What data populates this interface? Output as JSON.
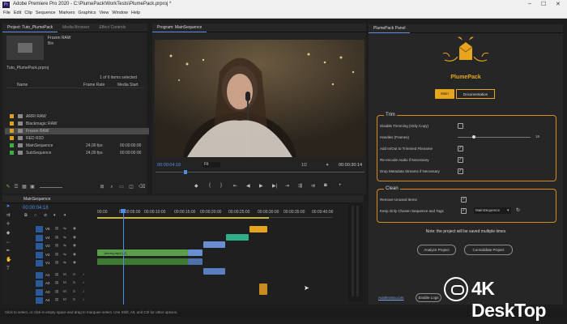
{
  "window": {
    "title": "Adobe Premiere Pro 2020 - C:\\PlumePack\\WorkTests\\PlumePack.prproj *",
    "logo": "Pr",
    "controls": [
      "–",
      "☐",
      "✕"
    ]
  },
  "menu": [
    "File",
    "Edit",
    "Clip",
    "Sequence",
    "Markers",
    "Graphics",
    "View",
    "Window",
    "Help"
  ],
  "project": {
    "tabs": [
      "Project: Tuto_PlumePack",
      "Media Browser",
      "Effect Controls"
    ],
    "preview_name": "Frozen RAW",
    "preview_sub": "Bin",
    "path": "Tuto_PlumePack.prproj",
    "status": "1 of 6 items selected",
    "columns": [
      "Name",
      "Frame Rate",
      "Media Start"
    ],
    "items": [
      {
        "name": "ARRI RAW",
        "fr": "",
        "ms": "",
        "color": "#e0a020",
        "sel": false
      },
      {
        "name": "Blackmagic RAW",
        "fr": "",
        "ms": "",
        "color": "#e0a020",
        "sel": false
      },
      {
        "name": "Frozen RAW",
        "fr": "",
        "ms": "",
        "color": "#e0a020",
        "sel": true
      },
      {
        "name": "RED R3D",
        "fr": "",
        "ms": "",
        "color": "#e0a020",
        "sel": false
      },
      {
        "name": "MainSequence",
        "fr": "24,00 fps",
        "ms": "00:00:00:00",
        "color": "#3fae49",
        "sel": false
      },
      {
        "name": "SubSequence",
        "fr": "24,00 fps",
        "ms": "00:00:00:00",
        "color": "#3fae49",
        "sel": false
      }
    ]
  },
  "program": {
    "tab": "Program: MainSequence",
    "timecode": "00:00:04:18",
    "fit": "Fit",
    "ratio": "1/2",
    "duration": "00:00:30:14"
  },
  "plumepack": {
    "tab": "PlumePack Panel",
    "title": "PlumePack",
    "tabs": [
      "Main",
      "Documentation"
    ],
    "trim": {
      "heading": "Trim",
      "options": [
        {
          "label": "Disable Trimming (Only Copy)",
          "checked": false
        },
        {
          "label": "Handles (Frames)",
          "checked": false
        },
        {
          "label": "Add In/Out to Trimmed Filename",
          "checked": true
        },
        {
          "label": "Re-encode Audio if Necessary",
          "checked": true
        },
        {
          "label": "Drop Metadata Streams if Necessary",
          "checked": true
        }
      ],
      "handles_value": "15"
    },
    "clean": {
      "heading": "Clean",
      "options": [
        {
          "label": "Remove Unused Items",
          "checked": true
        },
        {
          "label": "Keep Only Chosen Sequence and Tags",
          "checked": true
        }
      ],
      "sequence_select": "MainSequence"
    },
    "note": "Note: the project will be saved multiple times",
    "analyze": "Analyze Project",
    "consolidate": "Consolidate Project",
    "footer_link": "Autokroma.com",
    "enable_logs": "Enable Logs"
  },
  "timeline": {
    "tab": "MainSequence",
    "timecode": "00:00:04:18",
    "ruler": [
      "00:00",
      "00:00:05:00",
      "00:00:10:00",
      "00:00:15:00",
      "00:00:20:00",
      "00:00:25:00",
      "00:00:30:00",
      "00:00:35:00",
      "00:00:40:00"
    ],
    "video_tracks": [
      "V5",
      "V4",
      "V3",
      "V2",
      "V1"
    ],
    "audio_tracks": [
      "A1",
      "A2",
      "A3",
      "A4"
    ],
    "clip_label": "Jeremy.mp4 [V]"
  },
  "statusbar": "Click to select, or click in empty space and drag to marquee select. Use Shift, Alt, and Ctrl for other options.",
  "watermark": "4K DeskTop"
}
